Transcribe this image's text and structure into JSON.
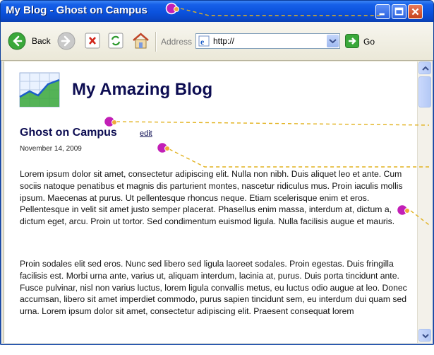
{
  "window": {
    "title": "My Blog - Ghost on Campus"
  },
  "toolbar": {
    "back_label": "Back",
    "address_label": "Address",
    "address_value": "http://",
    "go_label": "Go"
  },
  "page": {
    "blog_title": "My Amazing Blog",
    "post_title": "Ghost on Campus",
    "edit_label": "edit",
    "post_date": "November 14, 2009",
    "paragraphs": [
      "Lorem ipsum dolor sit amet, consectetur adipiscing elit. Nulla non nibh. Duis aliquet leo et ante. Cum sociis natoque penatibus et magnis dis parturient montes, nascetur ridiculus mus. Proin iaculis mollis ipsum. Maecenas at purus. Ut pellentesque rhoncus neque. Etiam scelerisque enim et eros. Pellentesque in velit sit amet justo semper placerat. Phasellus enim massa, interdum at, dictum a, dictum eget, arcu. Proin ut tortor. Sed condimentum euismod ligula. Nulla facilisis augue et mauris.",
      "Proin sodales elit sed eros. Nunc sed libero sed ligula laoreet sodales. Proin egestas. Duis fringilla facilisis est. Morbi urna ante, varius ut, aliquam interdum, lacinia at, purus. Duis porta tincidunt ante. Fusce pulvinar, nisl non varius luctus, lorem ligula convallis metus, eu luctus odio augue at leo. Donec accumsan, libero sit amet imperdiet commodo, purus sapien tincidunt sem, eu interdum dui quam sed urna. Lorem ipsum dolor sit amet, consectetur adipiscing elit. Praesent consequat lorem"
    ]
  },
  "colors": {
    "title_bar": "#0b52dd",
    "heading": "#0d0d52",
    "callout_dot": "#c21fb6",
    "callout_line": "#e2b21f"
  },
  "icons": {
    "back": "back-arrow-icon",
    "forward": "forward-arrow-icon",
    "stop": "stop-x-icon",
    "refresh": "refresh-icon",
    "home": "home-icon",
    "go": "go-arrow-icon",
    "logo": "chart-logo-icon",
    "callout": "callout-pin-icon"
  }
}
